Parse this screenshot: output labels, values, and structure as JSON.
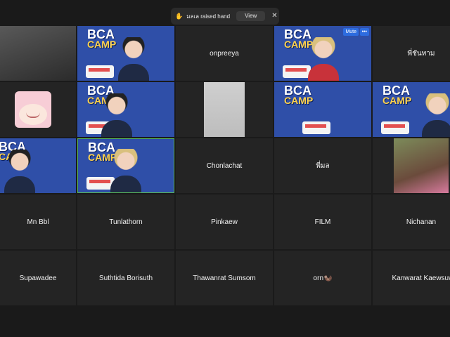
{
  "notification": {
    "icon": "raised-hand-icon",
    "message": "มลเล raised hand",
    "view_label": "View",
    "close_glyph": "✕"
  },
  "tile_controls": {
    "mute_label": "Mute",
    "more_label": "•••"
  },
  "branding": {
    "camp_line1": "BCA",
    "camp_line2": "CAMP"
  },
  "participants": {
    "r1c3": "onpreeya",
    "r1c5": "พี่ชันทาม",
    "r3c3": "Chonlachat",
    "r3c4": "พี่มล",
    "r4c1": "Mn Bbl",
    "r4c2": "Tunlathorn",
    "r4c3": "Pinkaew",
    "r4c4": "FILM",
    "r4c5": "Nichanan",
    "r5c1": "Supawadee",
    "r5c2": "Suthtida Borisuth",
    "r5c3": "Thawanrat Sumsom",
    "r5c4": "orn🦦",
    "r5c5": "Kanwarat Kaewsuwan"
  },
  "colors": {
    "background": "#1a1a1a",
    "tile": "#242424",
    "camp_blue": "#2f4fa8",
    "active_border": "#58b85c",
    "mute_button": "#2d6cdf"
  }
}
